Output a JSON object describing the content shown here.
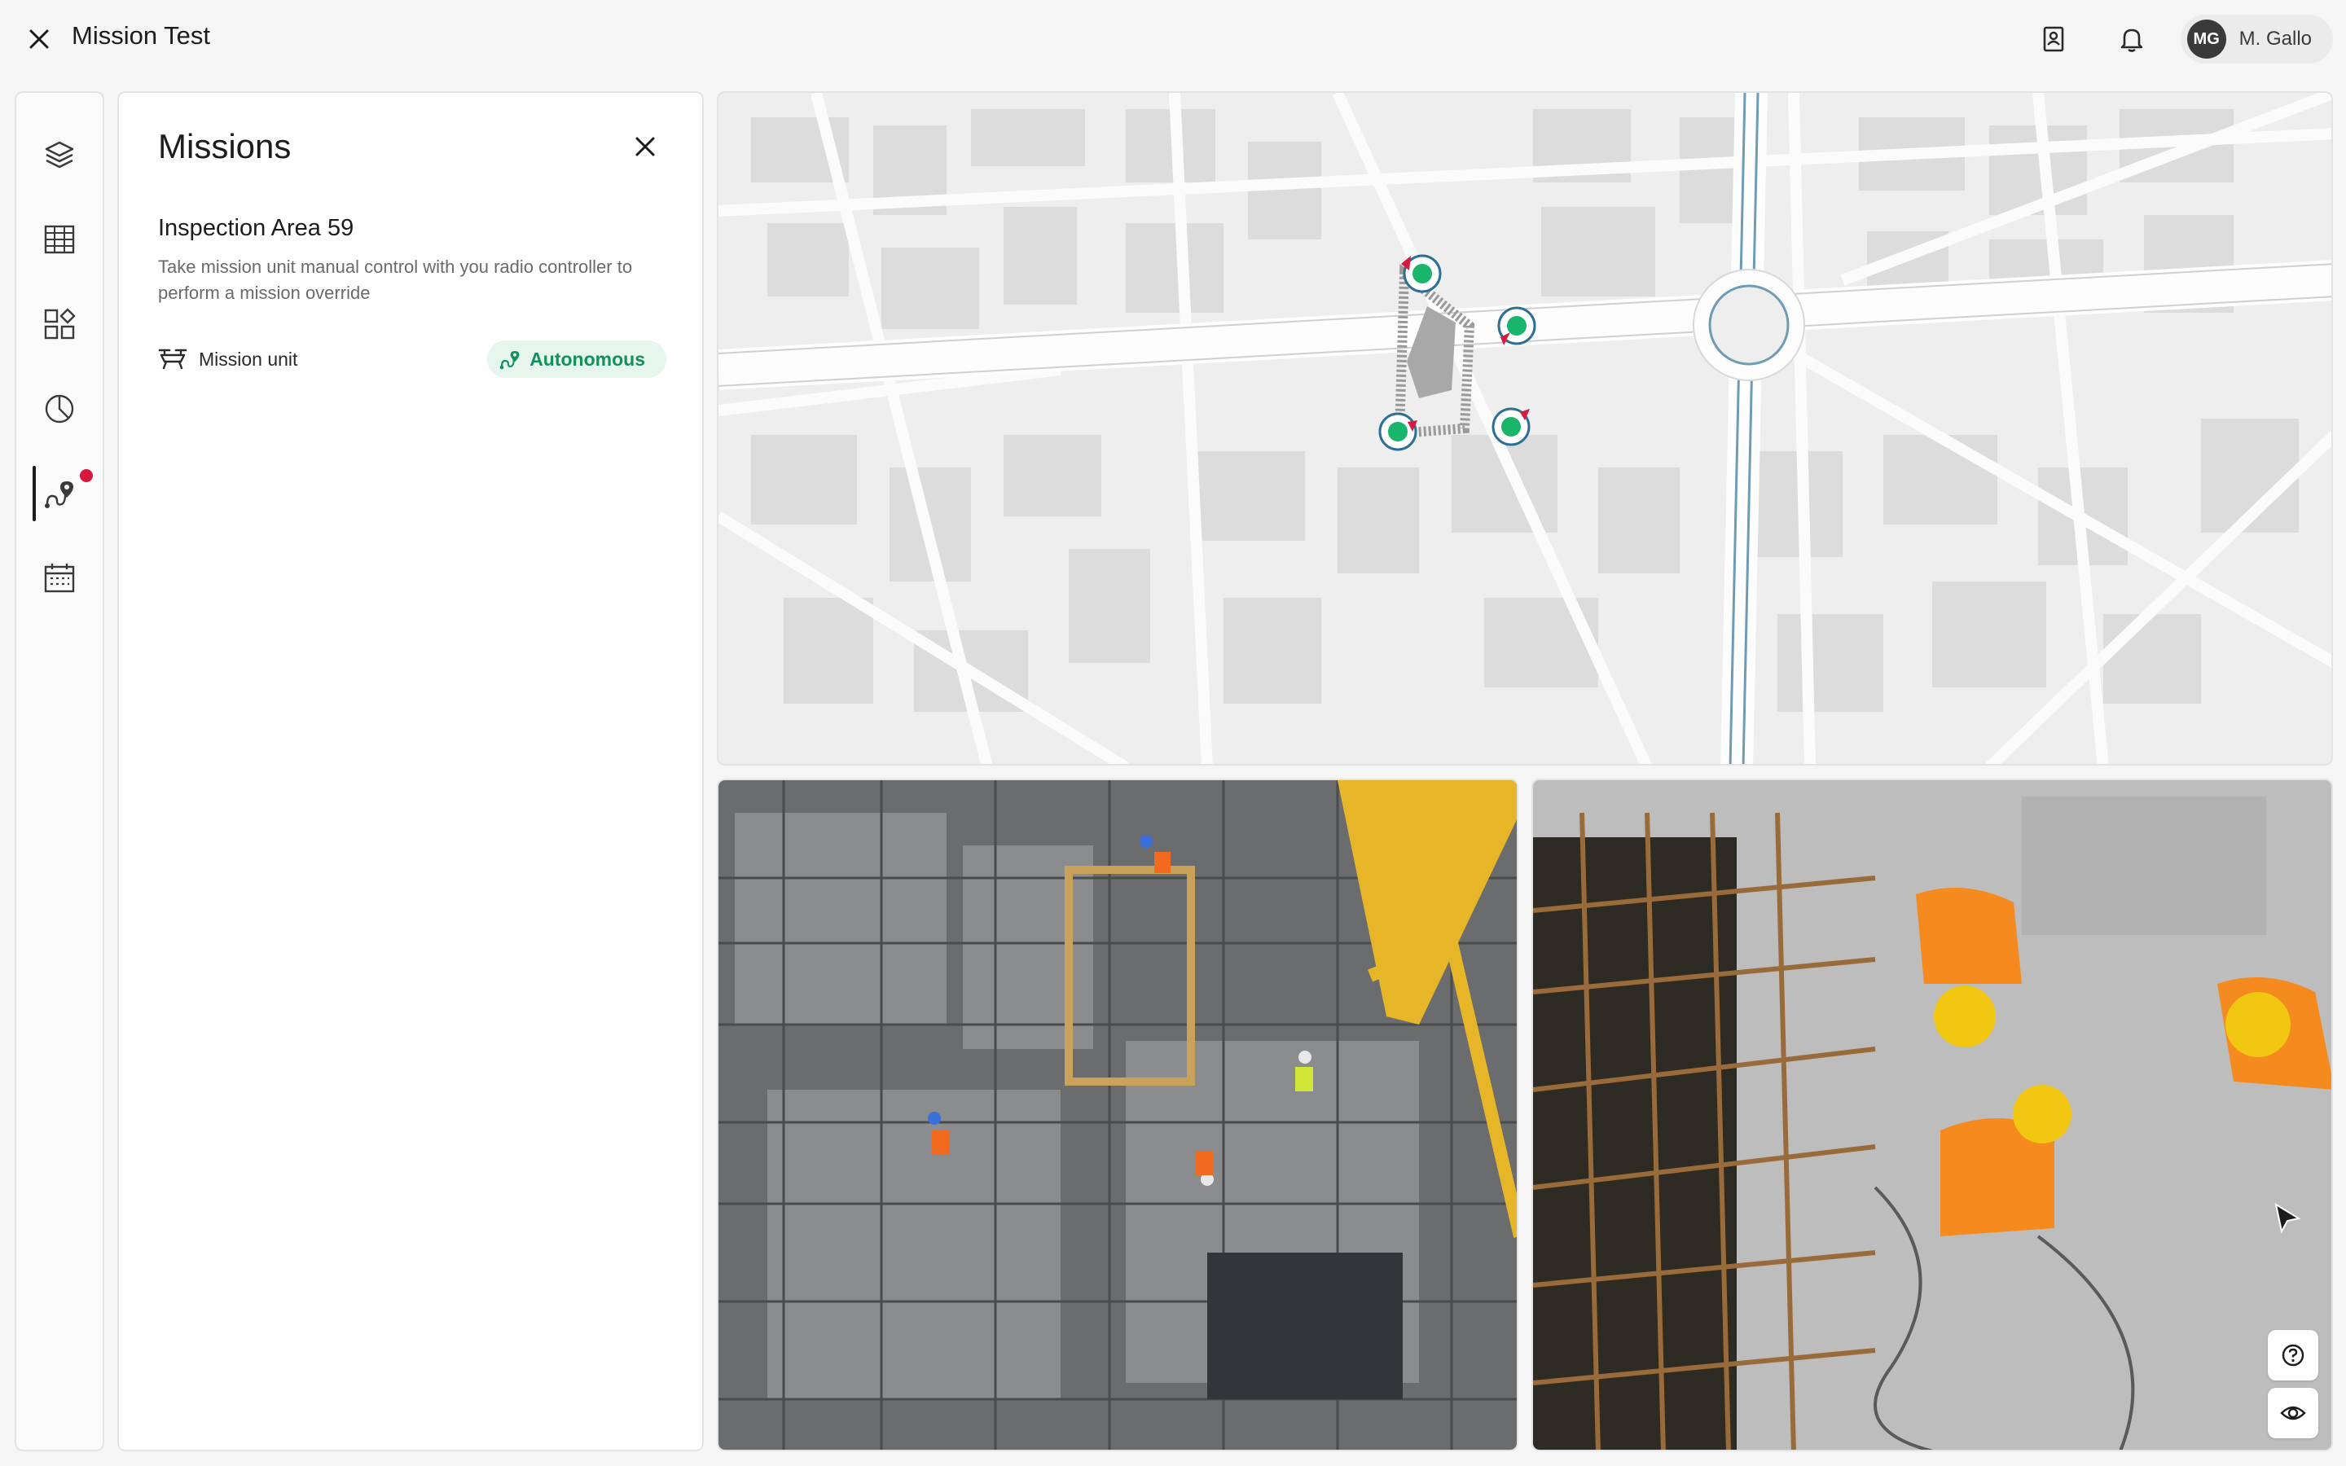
{
  "header": {
    "title": "Mission Test",
    "user": {
      "initials": "MG",
      "name": "M. Gallo"
    }
  },
  "rail": {
    "items": [
      {
        "icon": "layers-icon"
      },
      {
        "icon": "table-icon"
      },
      {
        "icon": "widgets-icon"
      },
      {
        "icon": "pie-chart-icon"
      },
      {
        "icon": "mission-route-icon",
        "active": true,
        "notification": true
      },
      {
        "icon": "calendar-icon"
      }
    ]
  },
  "missions": {
    "title": "Missions",
    "mission_name": "Inspection Area 59",
    "description": "Take mission unit manual control with you radio controller to perform a mission override",
    "unit_label": "Mission unit",
    "status": "Autonomous"
  },
  "map": {
    "waypoint_color": "#18b56a",
    "ring_color": "#2b6f96",
    "arrow_color": "#d7193f"
  },
  "colors": {
    "accent_green": "#14915a",
    "pill_bg": "#e6f5ee",
    "notification": "#d7193f"
  }
}
